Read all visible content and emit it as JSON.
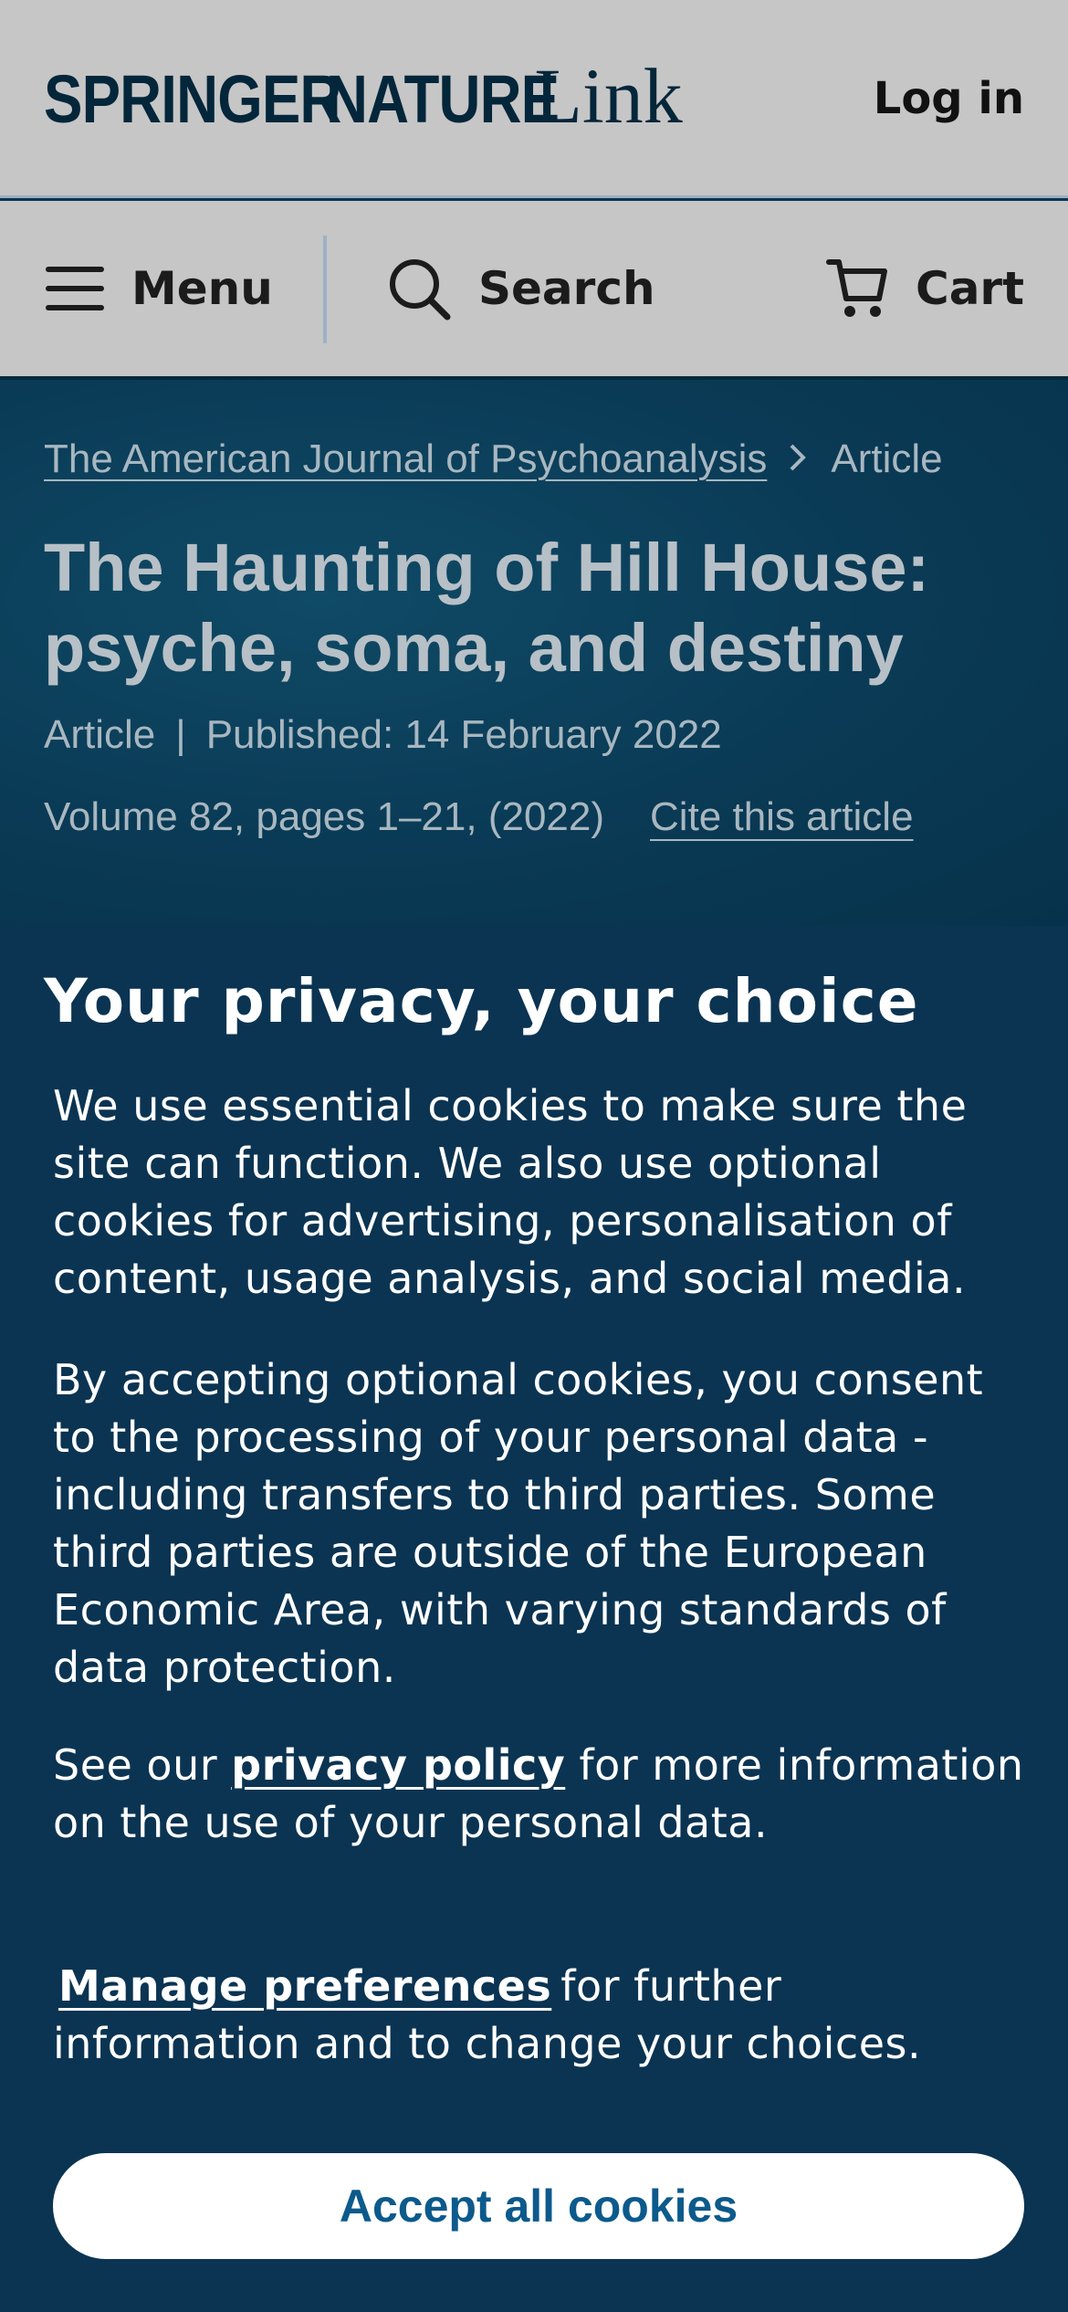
{
  "header": {
    "logo": {
      "word1": "SPRINGER",
      "word2": "NATURE",
      "word3": "Link"
    },
    "login_label": "Log in"
  },
  "nav": {
    "menu_label": "Menu",
    "search_label": "Search",
    "cart_label": "Cart"
  },
  "article": {
    "breadcrumb": [
      "The American Journal of Psychoanalysis",
      "Article"
    ],
    "title_line1": "The Haunting of Hill House:",
    "title_line2": "psyche, soma, and destiny",
    "type": "Article",
    "separator": "|",
    "published": "Published: 14 February 2022",
    "volume": "Volume 82, pages 1–21, (2022)",
    "cite_label": "Cite this article"
  },
  "cookie_banner": {
    "title": "Your privacy, your choice",
    "paragraph1": "We use essential cookies to make sure the site can function. We also use optional cookies for advertising, personalisation of content, usage analysis, and social media.",
    "paragraph2": "By accepting optional cookies, you consent to the processing of your personal data - including transfers to third parties. Some third parties are outside of the European Economic Area, with varying standards of data protection.",
    "paragraph3_prefix": "See our",
    "privacy_link": "privacy policy",
    "paragraph3_suffix": "for more information on the use of your personal data.",
    "manage_link": "Manage preferences",
    "paragraph4_suffix": "for further information and to change your choices.",
    "accept_label": "Accept all cookies"
  },
  "colors": {
    "header_bg": "#c6c6c6",
    "brand_dark": "#04263a",
    "banner_bg": "#0b3452",
    "button_text": "#0c5a8c"
  },
  "icons": [
    "menu-icon",
    "search-icon",
    "cart-icon",
    "chevron-right-icon"
  ]
}
